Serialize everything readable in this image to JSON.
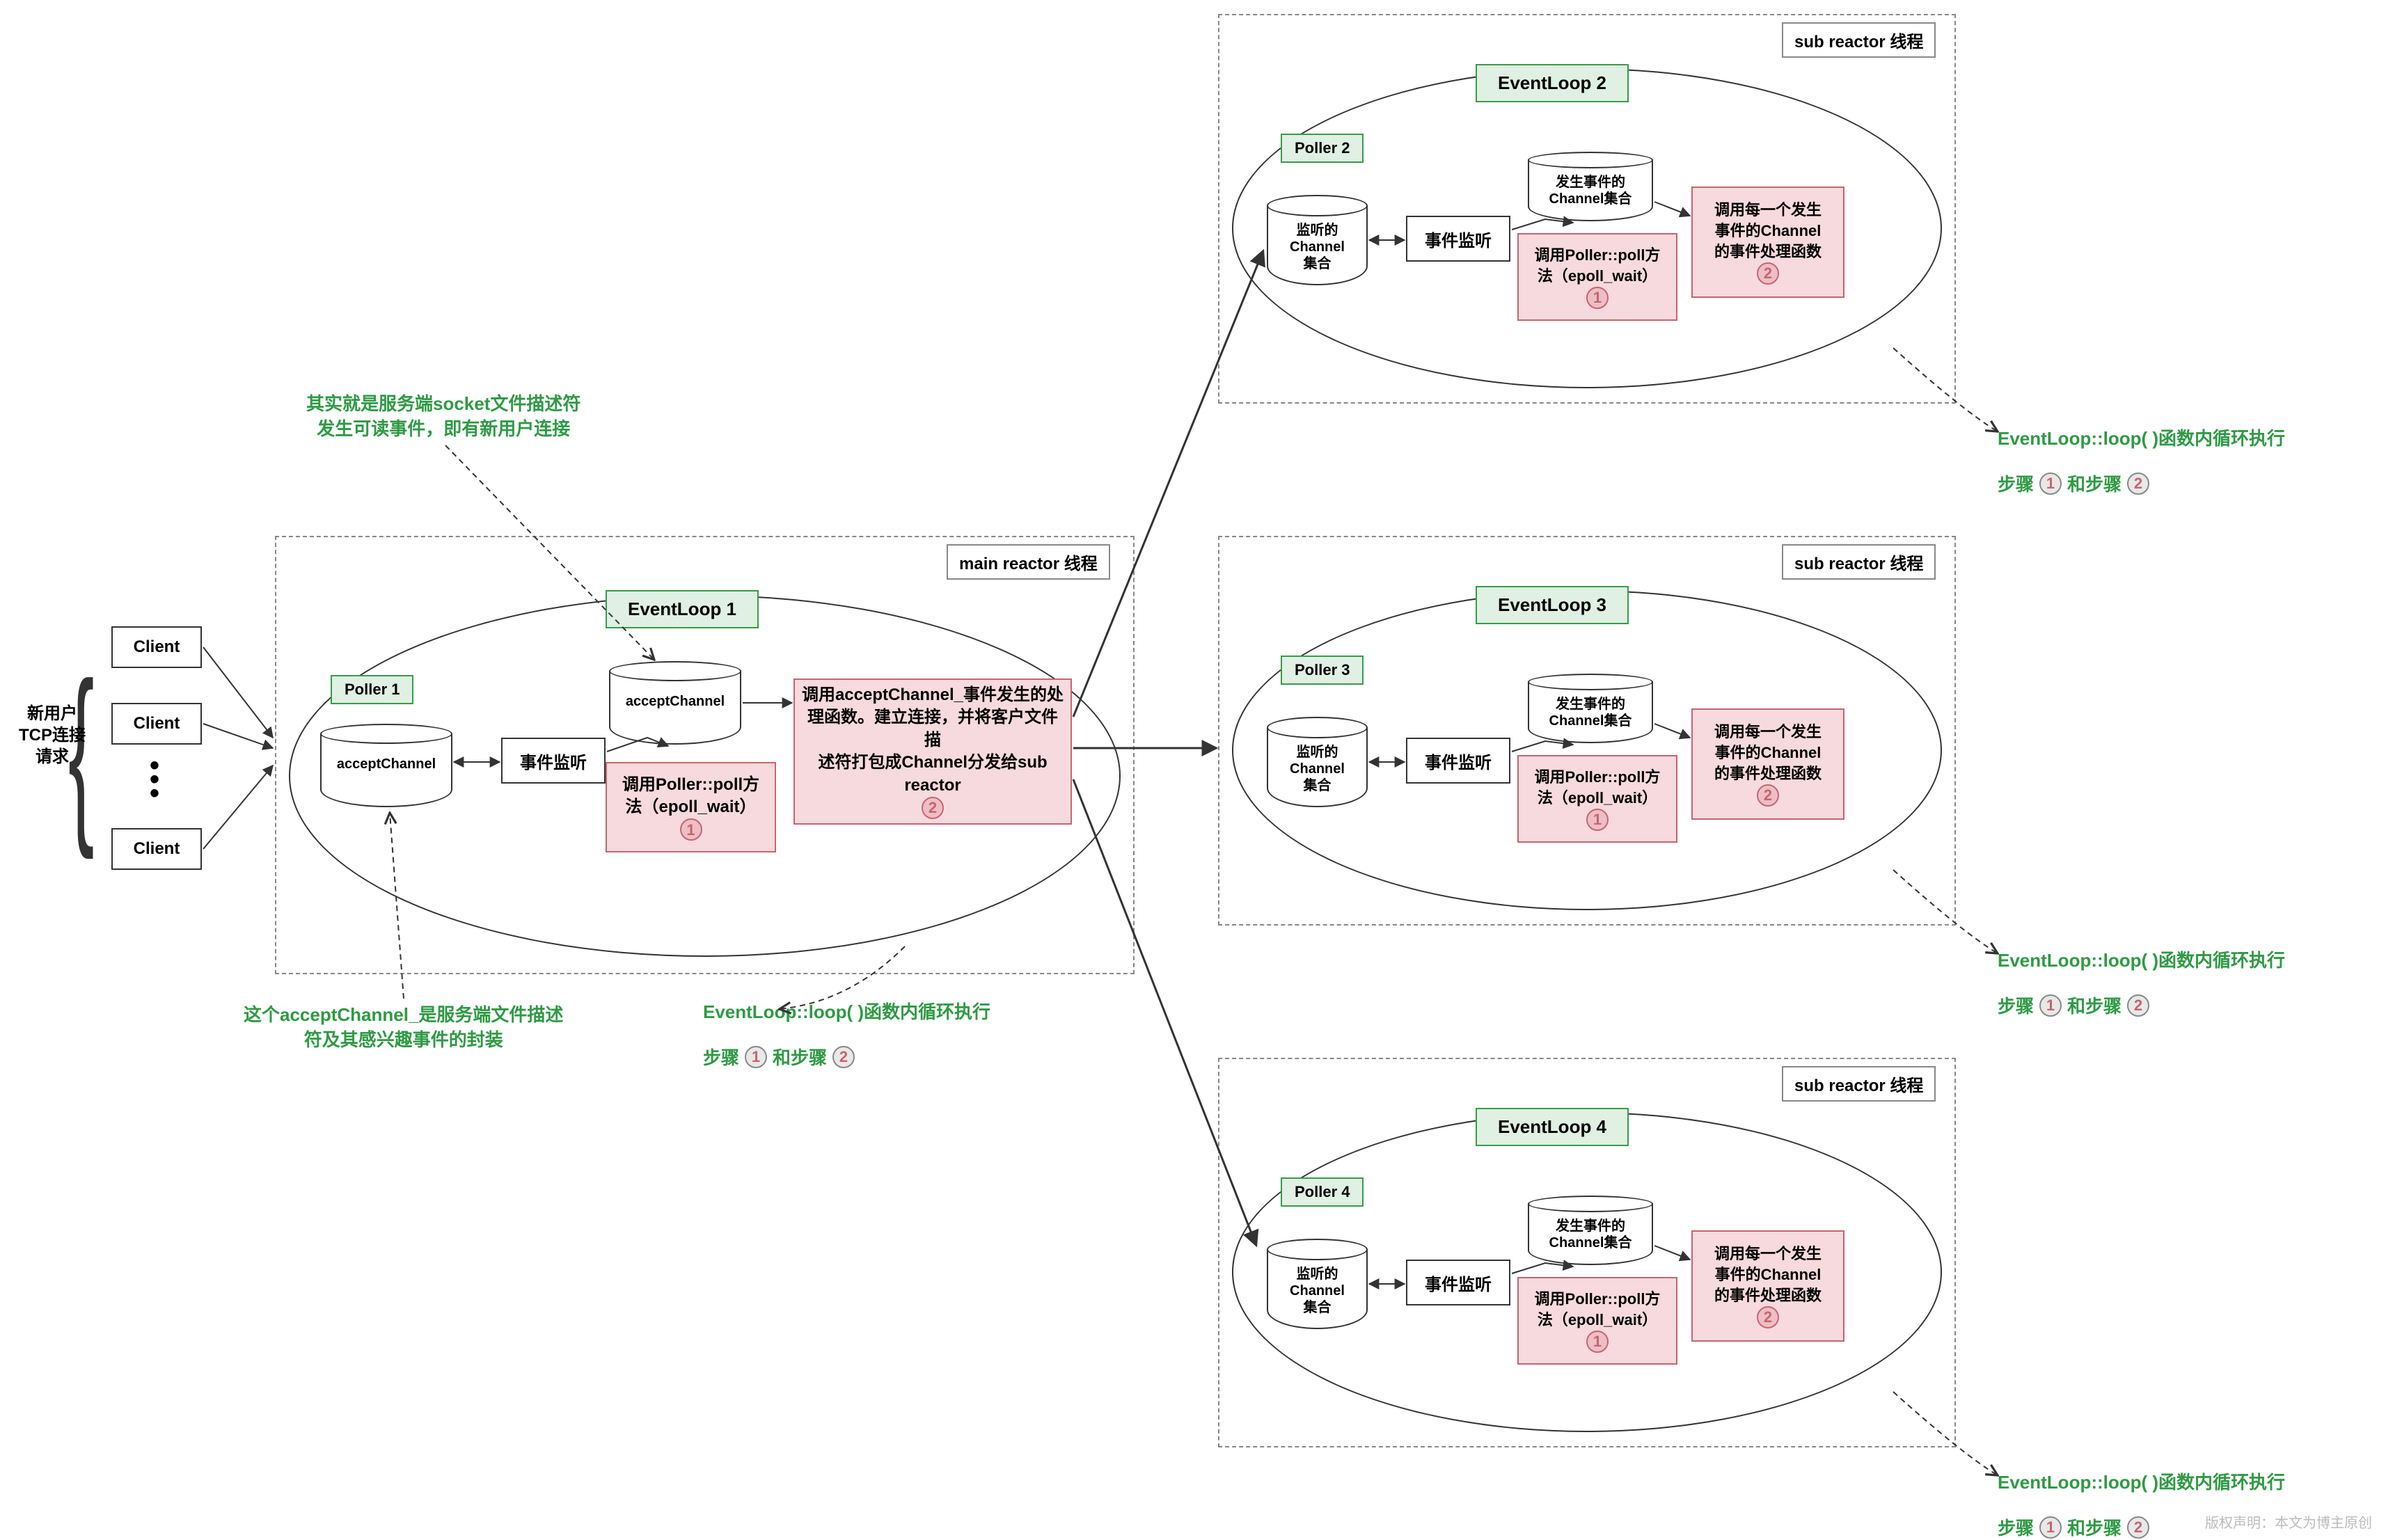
{
  "left": {
    "client_label": "Client",
    "brace_label_l1": "新用户",
    "brace_label_l2": "TCP连接",
    "brace_label_l3": "请求"
  },
  "annotations": {
    "top_note_l1": "其实就是服务端socket文件描述符",
    "top_note_l2": "发生可读事件，即有新用户连接",
    "bottom_note_l1": "这个acceptChannel_是服务端文件描述",
    "bottom_note_l2": "符及其感兴趣事件的封装"
  },
  "main": {
    "outer_title": "main reactor 线程",
    "eventloop": "EventLoop 1",
    "poller": "Poller 1",
    "cyl_accept": "acceptChannel",
    "listen": "事件监听",
    "cyl_accept2": "acceptChannel",
    "poll_l1": "调用Poller::poll方",
    "poll_l2": "法（epoll_wait）",
    "handler_l1": "调用acceptChannel_事件发生的处",
    "handler_l2": "理函数。建立连接，并将客户文件描",
    "handler_l3": "述符打包成Channel分发给sub",
    "handler_l4": "reactor",
    "loop_text": "EventLoop::loop( )函数内循环执行",
    "step_prefix": "步骤",
    "step_mid": "和步骤"
  },
  "sub_title": "sub reactor 线程",
  "sub": {
    "cyl_l1": "监听的",
    "cyl_l2": "Channel",
    "cyl_l3": "集合",
    "listen": "事件监听",
    "cyl2_l1": "发生事件的",
    "cyl2_l2": "Channel集合",
    "poll_l1": "调用Poller::poll方",
    "poll_l2": "法（epoll_wait）",
    "handler_l1": "调用每一个发生",
    "handler_l2": "事件的Channel",
    "handler_l3": "的事件处理函数",
    "loop_text": "EventLoop::loop( )函数内循环执行",
    "step_prefix": "步骤",
    "step_mid": "和步骤"
  },
  "sub2_eventloop": "EventLoop 2",
  "sub2_poller": "Poller 2",
  "sub3_eventloop": "EventLoop 3",
  "sub3_poller": "Poller 3",
  "sub4_eventloop": "EventLoop 4",
  "sub4_poller": "Poller 4",
  "badges": {
    "one": "1",
    "two": "2"
  },
  "watermark": "版权声明：本文为博主原创"
}
